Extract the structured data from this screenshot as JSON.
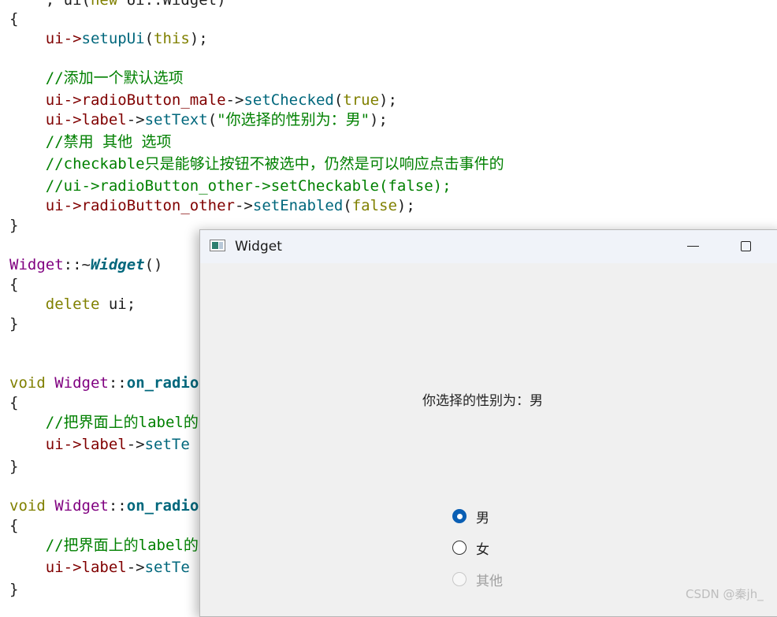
{
  "code": {
    "l0": {
      "a": "    , ui(",
      "b": "new",
      "c": " Ui::Widget)"
    },
    "l1": "{",
    "l2": {
      "a": "    ui->",
      "b": "setupUi",
      "c": "(",
      "d": "this",
      "e": ");"
    },
    "l4": "    //添加一个默认选项",
    "l5": {
      "a": "    ui->",
      "b": "radioButton_male",
      "c": "->",
      "d": "setChecked",
      "e": "(",
      "f": "true",
      "g": ");"
    },
    "l6": {
      "a": "    ui->",
      "b": "label",
      "c": "->",
      "d": "setText",
      "e": "(",
      "f": "\"你选择的性别为：男\"",
      "g": ");"
    },
    "l7": "    //禁用 其他 选项",
    "l8": "    //checkable只是能够让按钮不被选中，仍然是可以响应点击事件的",
    "l9": "    //ui->radioButton_other->setCheckable(false);",
    "l10": {
      "a": "    ui->",
      "b": "radioButton_other",
      "c": "->",
      "d": "setEnabled",
      "e": "(",
      "f": "false",
      "g": ");"
    },
    "l11": "}",
    "l13": {
      "a": "Widget",
      "b": "::~",
      "c": "Widget",
      "d": "()"
    },
    "l14": "{",
    "l15": {
      "a": "    ",
      "b": "delete",
      "c": " ui;"
    },
    "l16": "}",
    "l19": {
      "a": "void",
      "b": " ",
      "c": "Widget",
      "d": "::",
      "e": "on_radio"
    },
    "l20": "{",
    "l21": "    //把界面上的label的",
    "l22": {
      "a": "    ui->",
      "b": "label",
      "c": "->",
      "d": "setTe"
    },
    "l23": "}",
    "l25": {
      "a": "void",
      "b": " ",
      "c": "Widget",
      "d": "::",
      "e": "on_radio"
    },
    "l26": "{",
    "l27": "    //把界面上的label的",
    "l28": {
      "a": "    ui->",
      "b": "label",
      "c": "->",
      "d": "setTe"
    },
    "l29": "}"
  },
  "window": {
    "title": "Widget",
    "label_text": "你选择的性别为：男",
    "radios": [
      {
        "label": "男",
        "checked": true,
        "enabled": true
      },
      {
        "label": "女",
        "checked": false,
        "enabled": true
      },
      {
        "label": "其他",
        "checked": false,
        "enabled": false
      }
    ]
  },
  "watermark": "CSDN @秦jh_",
  "colors": {
    "keyword": "#808000",
    "function": "#00677c",
    "type": "#800080",
    "comment": "#008000",
    "accent": "#0a5fb4"
  }
}
